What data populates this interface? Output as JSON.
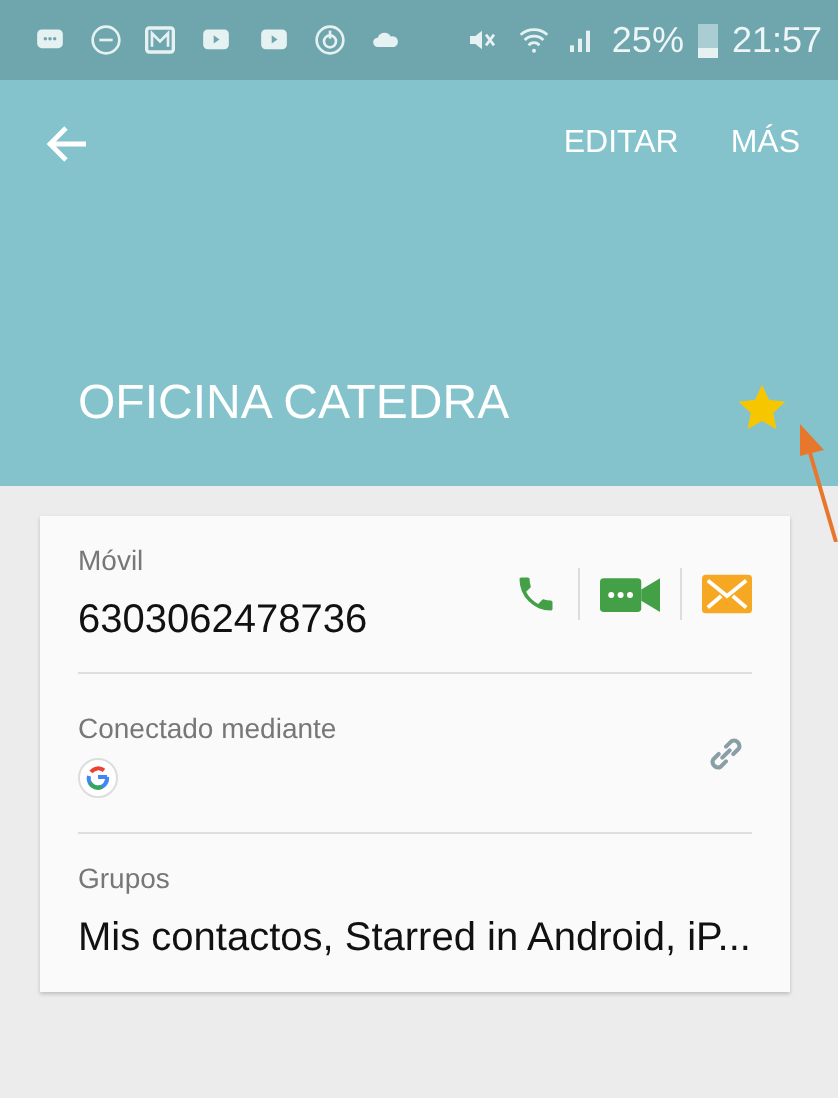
{
  "status_bar": {
    "battery": "25%",
    "time": "21:57"
  },
  "toolbar": {
    "actions": [
      "EDITAR",
      "MÁS"
    ]
  },
  "contact": {
    "name": "OFICINA CATEDRA",
    "starred": true
  },
  "fields": [
    {
      "kind": "phone",
      "label": "Móvil",
      "value": "6303062478736"
    },
    {
      "kind": "account",
      "label": "Conectado mediante"
    },
    {
      "kind": "text",
      "label": "Grupos",
      "value": "Mis contactos, Starred in Android, iP..."
    }
  ]
}
